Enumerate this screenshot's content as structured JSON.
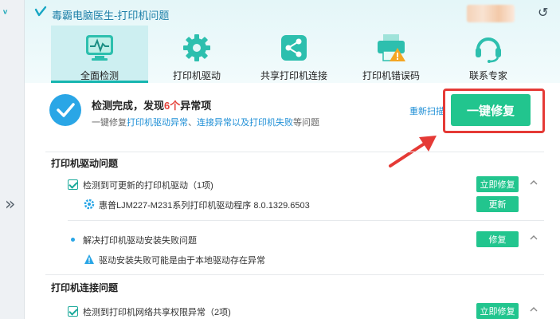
{
  "window": {
    "title": "毒霸电脑医生-打印机问题",
    "collapse_glyph": "»"
  },
  "tabs": [
    {
      "label": "全面检测",
      "icon": "monitor-pulse-icon",
      "active": true
    },
    {
      "label": "打印机驱动",
      "icon": "gear-icon",
      "active": false
    },
    {
      "label": "共享打印机连接",
      "icon": "share-icon",
      "active": false
    },
    {
      "label": "打印机错误码",
      "icon": "printer-warning-icon",
      "active": false
    },
    {
      "label": "联系专家",
      "icon": "headset-icon",
      "active": false
    }
  ],
  "summary": {
    "title_prefix": "检测完成，发现",
    "count": "6个",
    "title_suffix": "异常项",
    "sub_prefix": "一键修复",
    "sub_link1": "打印机驱动异常",
    "sub_sep": "、",
    "sub_link2": "连接异常以及打印机失败",
    "sub_suffix": "等问题",
    "rescan": "重新扫描",
    "fix_all": "一键修复"
  },
  "sections": [
    {
      "title": "打印机驱动问题",
      "items": [
        {
          "text": "检测到可更新的打印机驱动（1项)",
          "button": "立即修复",
          "sub_text": "惠普LJM227-M231系列打印机驱动程序 8.0.1329.6503",
          "sub_button": "更新"
        },
        {
          "text": "解决打印机驱动安装失败问题",
          "button": "修复",
          "sub_text": "驱动安装失败可能是由于本地驱动存在异常"
        }
      ]
    },
    {
      "title": "打印机连接问题",
      "items": [
        {
          "text": "检测到打印机网络共享权限异常（2项)",
          "button": "立即修复"
        }
      ]
    }
  ],
  "colors": {
    "accent": "#22c58e",
    "link": "#1f8fd6",
    "highlight": "#e53a36",
    "teal": "#17b6b0"
  }
}
